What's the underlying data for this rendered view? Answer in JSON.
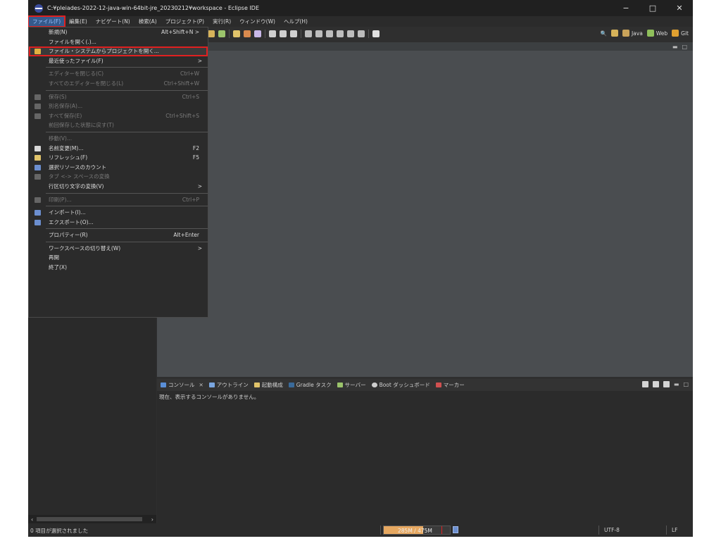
{
  "window": {
    "title": "C:¥pleiades-2022-12-java-win-64bit-jre_20230212¥workspace - Eclipse IDE",
    "controls": [
      "−",
      "□",
      "✕"
    ]
  },
  "menubar": [
    "ファイル(F)",
    "編集(E)",
    "ナビゲート(N)",
    "検索(A)",
    "プロジェクト(P)",
    "実行(R)",
    "ウィンドウ(W)",
    "ヘルプ(H)"
  ],
  "perspectives": [
    "Java",
    "Web",
    "Git"
  ],
  "file_menu": {
    "items": [
      {
        "label": "新規(N)",
        "shortcut": "Alt+Shift+N >",
        "enabled": true
      },
      {
        "label": "ファイルを開く(.)...",
        "enabled": true
      },
      {
        "label": "ファイル・システムからプロジェクトを開く...",
        "enabled": true,
        "highlighted": true,
        "icon": "folder-icon"
      },
      {
        "label": "最近使ったファイル(F)",
        "arrow": ">",
        "enabled": true
      },
      {
        "sep": true
      },
      {
        "label": "エディターを閉じる(C)",
        "shortcut": "Ctrl+W",
        "enabled": false
      },
      {
        "label": "すべてのエディターを閉じる(L)",
        "shortcut": "Ctrl+Shift+W",
        "enabled": false
      },
      {
        "sep": true
      },
      {
        "label": "保存(S)",
        "shortcut": "Ctrl+S",
        "enabled": false,
        "icon": "save-icon"
      },
      {
        "label": "別名保存(A)...",
        "enabled": false,
        "icon": "save-as-icon"
      },
      {
        "label": "すべて保存(E)",
        "shortcut": "Ctrl+Shift+S",
        "enabled": false,
        "icon": "save-all-icon"
      },
      {
        "label": "前回保存した状態に戻す(T)",
        "enabled": false
      },
      {
        "sep": true
      },
      {
        "label": "移動(V)...",
        "enabled": false
      },
      {
        "label": "名前変更(M)...",
        "shortcut": "F2",
        "enabled": true,
        "icon": "rename-icon"
      },
      {
        "label": "リフレッシュ(F)",
        "shortcut": "F5",
        "enabled": true,
        "icon": "refresh-icon"
      },
      {
        "label": "選択リソースのカウント",
        "enabled": true,
        "icon": "count-icon"
      },
      {
        "label": "タブ <-> スペースの変換",
        "enabled": false,
        "icon": "convert-icon"
      },
      {
        "label": "行区切り文字の変換(V)",
        "arrow": ">",
        "enabled": true
      },
      {
        "sep": true
      },
      {
        "label": "印刷(P)...",
        "shortcut": "Ctrl+P",
        "enabled": false,
        "icon": "print-icon"
      },
      {
        "sep": true
      },
      {
        "label": "インポート(I)...",
        "enabled": true,
        "icon": "import-icon"
      },
      {
        "label": "エクスポート(O)...",
        "enabled": true,
        "icon": "export-icon"
      },
      {
        "sep": true
      },
      {
        "label": "プロパティー(R)",
        "shortcut": "Alt+Enter",
        "enabled": true
      },
      {
        "sep": true
      },
      {
        "label": "ワークスペースの切り替え(W)",
        "arrow": ">",
        "enabled": true
      },
      {
        "label": "再開",
        "enabled": true
      },
      {
        "label": "終了(X)",
        "enabled": true
      }
    ]
  },
  "console": {
    "tabs": [
      "コンソール",
      "アウトライン",
      "起動構成",
      "Gradle タスク",
      "サーバー",
      "Boot ダッシュボード",
      "マーカー"
    ],
    "message": "現在、表示するコンソールがありません。"
  },
  "status": {
    "selection": "0 項目が選択されました",
    "heap": "285M / 475M",
    "heap_used_fraction": 0.6,
    "encoding": "UTF-8",
    "line_end": "LF"
  },
  "colors": {
    "accent": "#355a8c",
    "highlight_border": "#e02020",
    "heap_fill": "#e6a861"
  }
}
